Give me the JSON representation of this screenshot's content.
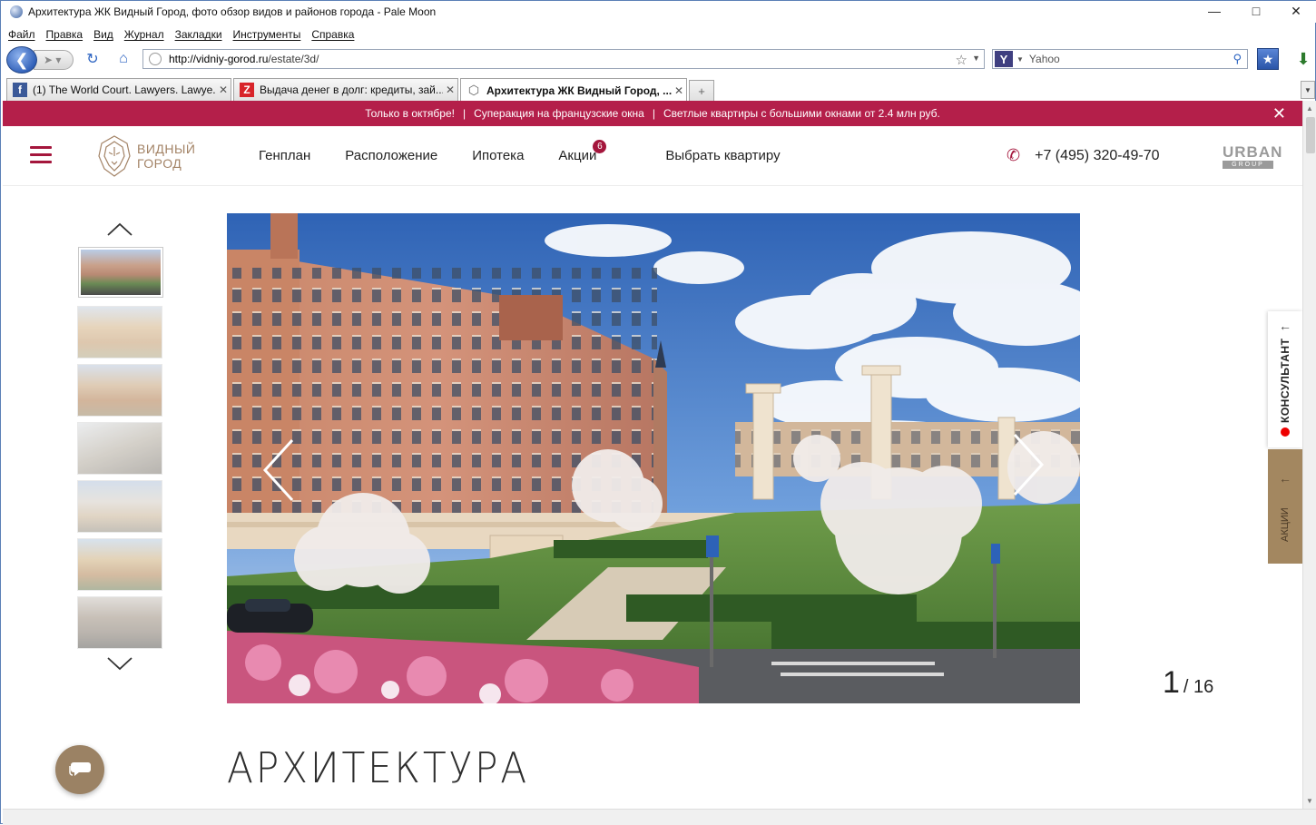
{
  "window": {
    "title": "Архитектура ЖК Видный Город, фото обзор видов и районов города - Pale Moon"
  },
  "menu": [
    "Файл",
    "Правка",
    "Вид",
    "Журнал",
    "Закладки",
    "Инструменты",
    "Справка"
  ],
  "navbar": {
    "url_host": "http://vidniy-gorod.ru",
    "url_path": "/estate/3d/",
    "search_placeholder": "Yahoo"
  },
  "tabs": [
    {
      "title": "(1) The World Court. Lawyers. Lawye...",
      "favicon": "facebook-icon"
    },
    {
      "title": "Выдача денег в долг: кредиты, зай...",
      "favicon": "z-icon"
    },
    {
      "title": "Архитектура ЖК Видный Город, ...",
      "favicon": "site-icon",
      "active": true
    }
  ],
  "promo": {
    "part1": "Только в октябре!",
    "part2": "Суперакция на французские окна",
    "part3": "Светлые квартиры с большими окнами от 2.4 млн руб.",
    "separator": "|",
    "close": "✕"
  },
  "header": {
    "logo_line1": "ВИДНЫЙ",
    "logo_line2": "ГОРОД",
    "nav": [
      "Генплан",
      "Расположение",
      "Ипотека",
      "Акции",
      "Выбрать квартиру"
    ],
    "promo_badge": "6",
    "phone": "+7 (495) 320-49-70",
    "partner_line1": "URBAN",
    "partner_line2": "GROUP"
  },
  "gallery": {
    "current": "1",
    "total": "/ 16",
    "thumbnail_count": 7,
    "selected_index": 0
  },
  "page": {
    "title": "АРХИТЕКТУРА"
  },
  "sidebar": {
    "consultant": "КОНСУЛЬТАНТ",
    "promos": "АКЦИИ"
  },
  "colors": {
    "brand": "#a4163c",
    "promo_bar": "#b41f4a",
    "accent_gold": "#a38760"
  }
}
